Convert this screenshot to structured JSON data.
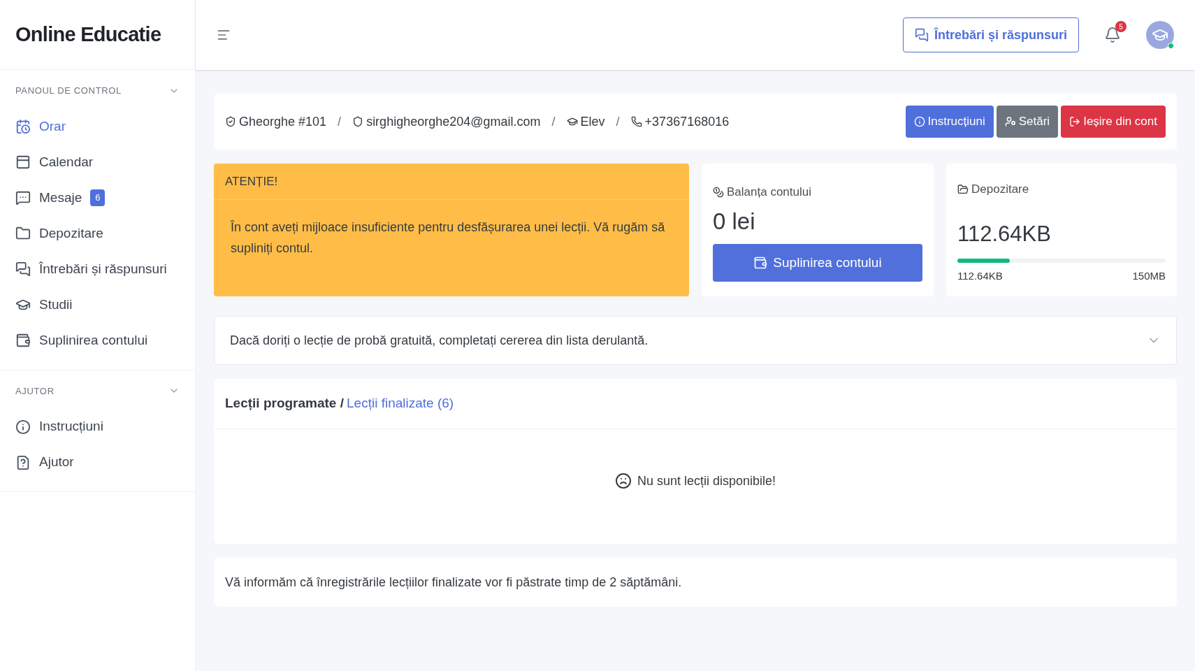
{
  "sidebar": {
    "logo": "Online Educatie",
    "sections": [
      {
        "title": "PANOUL DE CONTROL",
        "expanded": true,
        "items": [
          {
            "kind": "schedule",
            "label": "Orar",
            "selected": true
          },
          {
            "kind": "calendar",
            "label": "Calendar",
            "selected": false
          },
          {
            "kind": "messages",
            "label": "Mesaje",
            "selected": false,
            "badge": "6"
          },
          {
            "kind": "folder",
            "label": "Depozitare",
            "selected": false
          },
          {
            "kind": "chat",
            "label": "Întrebări și răspunsuri",
            "selected": false
          },
          {
            "kind": "studies",
            "label": "Studii",
            "selected": false
          },
          {
            "kind": "wallet",
            "label": "Suplinirea contului",
            "selected": false
          }
        ]
      },
      {
        "title": "AJUTOR",
        "expanded": true,
        "items": [
          {
            "kind": "info",
            "label": "Instrucțiuni",
            "selected": false
          },
          {
            "kind": "help",
            "label": "Ajutor",
            "selected": false
          }
        ]
      }
    ]
  },
  "topbar": {
    "qa_button": "Întrebări și răspunsuri",
    "notifications": "5"
  },
  "profile": {
    "fields": [
      {
        "kind": "user",
        "text": "Gheorghe #101"
      },
      {
        "kind": "email",
        "separator": "/",
        "text": "sirghigheorghe204@gmail.com"
      },
      {
        "kind": "role",
        "separator": "/",
        "text": "Elev"
      },
      {
        "kind": "phone",
        "separator": "/",
        "text": "+37367168016"
      }
    ],
    "buttons": [
      {
        "kind": "info",
        "label": "Instrucțiuni"
      },
      {
        "kind": "settings",
        "label": "Setări"
      },
      {
        "kind": "logout",
        "label": "Ieșire din cont"
      }
    ]
  },
  "alert": {
    "title": "ATENȚIE!",
    "text": "În cont aveți mijloace insuficiente pentru desfășurarea unei lecții. Vă rugăm să supliniți contul."
  },
  "balance": {
    "title": "Balanța contului",
    "amount": "0 lei",
    "button": "Suplinirea contului"
  },
  "storage": {
    "title": "Depozitare",
    "used": "112.64KB",
    "level": 0.25,
    "min_label": "112.64KB",
    "max_label": "150MB"
  },
  "trial": {
    "text": "Dacă doriți o lecție de probă gratuită, completați cererea din lista derulantă.",
    "expanded": false
  },
  "lessons": {
    "title": "Lecții programate /",
    "link": "Lecții finalizate (6)",
    "empty": "Nu sunt lecții disponibile!"
  },
  "note": "Vă informăm că înregistrările lecțiilor finalizate vor fi păstrate timp de 2 săptămâni."
}
